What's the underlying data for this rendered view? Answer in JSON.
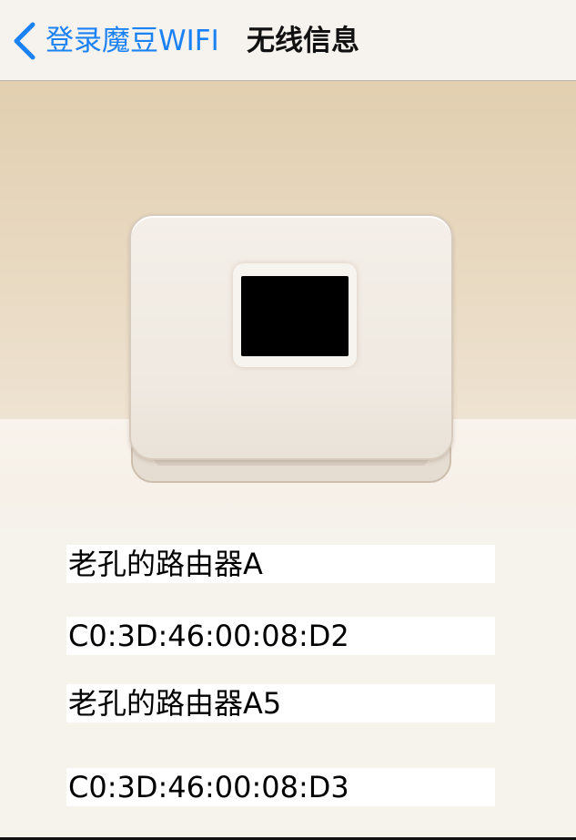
{
  "navbar": {
    "back_label": "登录魔豆WIFI",
    "title": "无线信息"
  },
  "colors": {
    "accent": "#1b82f5",
    "navbar_bg": "#f6f3ee",
    "hero_top": "#e2cfb0",
    "page_bg": "#f6f2ec"
  },
  "icons": {
    "back": "chevron-left-icon",
    "router": "router-illustration"
  },
  "wifi_info": [
    {
      "label": "老孔的路由器A"
    },
    {
      "label": "C0:3D:46:00:08:D2"
    },
    {
      "label": "老孔的路由器A5"
    },
    {
      "label": "C0:3D:46:00:08:D3"
    }
  ]
}
